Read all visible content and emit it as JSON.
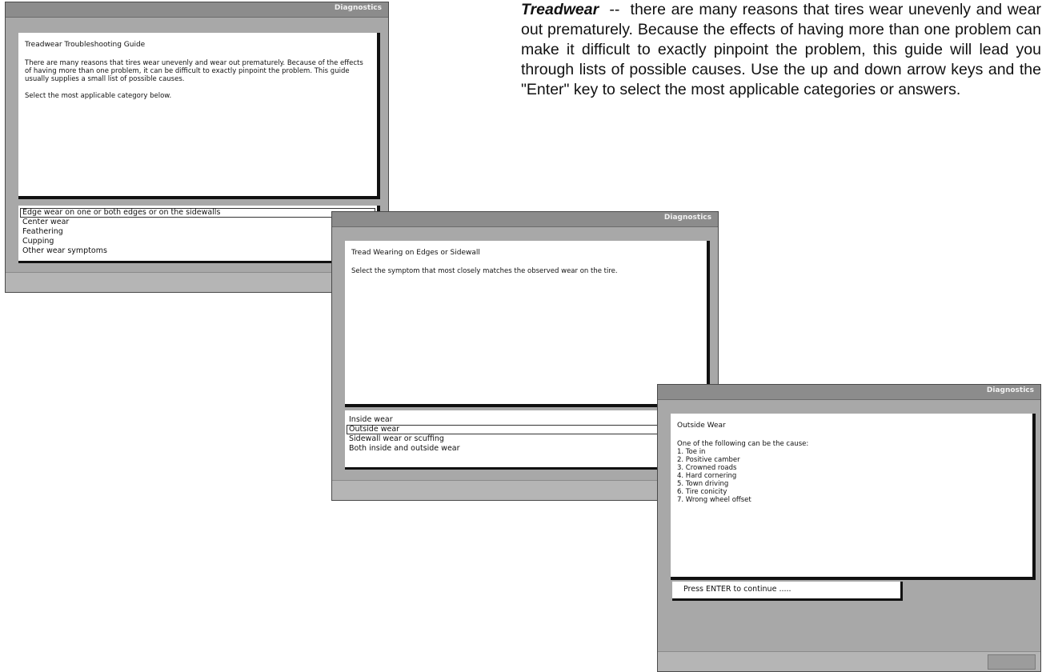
{
  "description": {
    "keyword": "Treadwear",
    "separator": "  --  ",
    "text": "there are many reasons that tires wear unevenly and wear out prematurely. Because the effects of having more than one problem can make it difficult to exactly pinpoint the problem, this guide will lead you through lists of possible causes. Use the up and down arrow keys and the \"Enter\" key to select the most applicable categories or answers."
  },
  "screen1": {
    "title": "Diagnostics",
    "heading": "Treadwear Troubleshooting Guide",
    "paragraph": "There are many reasons that tires wear unevenly and wear out prematurely. Because of the effects of having more than one problem, it can be difficult to exactly pinpoint the problem. This guide usually supplies a small list of possible causes.",
    "instruction": "Select the most applicable category below.",
    "options": [
      "Edge wear on one or both edges or on the sidewalls",
      "Center wear",
      "Feathering",
      "Cupping",
      "Other wear symptoms"
    ],
    "selected_index": 0
  },
  "screen2": {
    "title": "Diagnostics",
    "heading": "Tread Wearing on Edges or Sidewall",
    "instruction": "Select the symptom that most closely matches the observed wear on the tire.",
    "options": [
      "Inside wear",
      "Outside wear",
      "Sidewall wear or scuffing",
      "Both inside and outside wear"
    ],
    "selected_index": 1
  },
  "screen3": {
    "title": "Diagnostics",
    "heading": "Outside Wear",
    "intro": "One of the following can be the cause:",
    "causes": [
      "1.  Toe in",
      "2.  Positive camber",
      "3.  Crowned roads",
      "4.  Hard cornering",
      "5.  Town driving",
      "6.  Tire conicity",
      "7.  Wrong wheel offset"
    ],
    "continue_text": "Press ENTER to continue ....."
  }
}
